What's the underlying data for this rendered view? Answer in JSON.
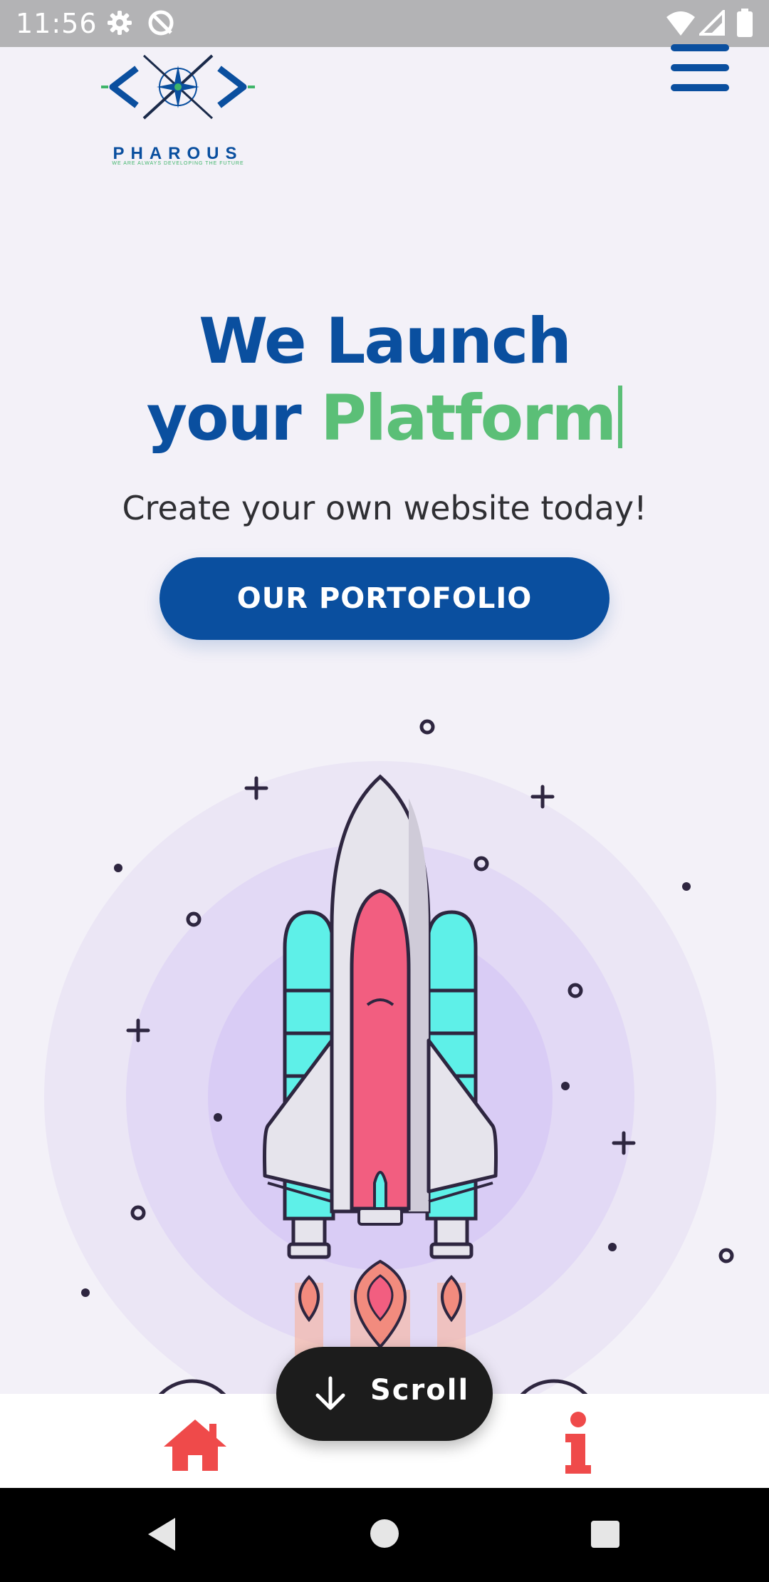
{
  "status_bar": {
    "time": "11:56",
    "icons": [
      "settings-gear-icon",
      "sync-circle-icon",
      "wifi-icon",
      "cell-signal-icon",
      "battery-icon"
    ]
  },
  "header": {
    "logo_name": "PHAROUS",
    "logo_tagline": "WE ARE ALWAYS DEVELOPING THE FUTURE",
    "menu_icon": "hamburger-menu-icon"
  },
  "hero": {
    "title_line1": "We Launch",
    "title_line2_prefix": "your ",
    "title_line2_accent": "Platform",
    "subtitle": "Create your own website today!",
    "cta_label": "OUR PORTOFOLIO"
  },
  "colors": {
    "brand_blue": "#0a4f9f",
    "accent_green": "#5bbf77",
    "page_bg": "#f3f1f8",
    "nav_icon_red": "#ef4a4a",
    "rocket_cyan": "#5ef0e8",
    "rocket_pink": "#f25e80"
  },
  "illustration": {
    "subject": "rocket-launch-illustration"
  },
  "scroll_button": {
    "label": "Scroll",
    "icon": "arrow-down-icon"
  },
  "bottom_nav": {
    "items": [
      {
        "icon": "home-icon"
      },
      {
        "icon": "info-icon"
      }
    ]
  },
  "system_nav": {
    "buttons": [
      "back-icon",
      "home-circle-icon",
      "recents-icon"
    ]
  }
}
